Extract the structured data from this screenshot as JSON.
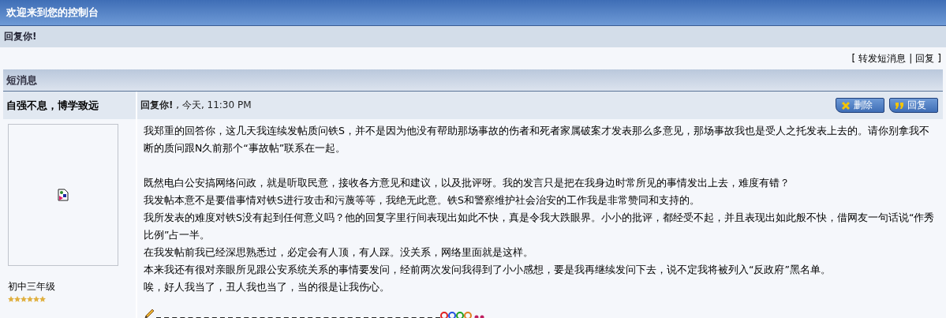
{
  "header": {
    "title": "欢迎来到您的控制台"
  },
  "subheader": {
    "title": "回复你!"
  },
  "links": {
    "open": "[",
    "items": [
      "转发短消息",
      "回复"
    ],
    "separator": "|",
    "close": "]"
  },
  "panel": {
    "title": "短消息",
    "author": {
      "name": "自强不息，博学致远",
      "rank": "初中三年级",
      "stars": 6
    },
    "message": {
      "title": "回复你!",
      "date": ", 今天, 11:30 PM",
      "buttons": [
        {
          "kind": "delete",
          "label": "删除"
        },
        {
          "kind": "reply",
          "label": "回复"
        }
      ],
      "paragraphs": [
        {
          "lines": [
            "我郑重的回答你，这几天我连续发帖质问铁S，并不是因为他没有帮助那场事故的伤者和死者家属破案才发表那么多意见，那场事故我也是受人之托发表上去的。请你别拿我不断的质问跟N久前那个“事故帖”联系在一起。"
          ]
        },
        {
          "lines": [
            "既然电白公安搞网络问政，就是听取民意，接收各方意见和建议，以及批评呀。我的发言只是把在我身边时常所见的事情发出上去，难度有错？",
            "我发帖本意不是要借事情对铁S进行攻击和污蔑等等，我绝无此意。铁S和警察维护社会治安的工作我是非常赞同和支持的。",
            "我所发表的难度对铁S没有起到任何意义吗？他的回复字里行间表现出如此不快，真是令我大跌眼界。小小的批评，都经受不起，并且表现出如此般不快，借网友一句话说“作秀比例”占一半。",
            "在我发帖前我已经深思熟悉过，必定会有人顶，有人踩。没关系，网络里面就是这样。",
            "本来我还有很对亲眼所见跟公安系统关系的事情要发问，经前两次发问我得到了小小感想，要是我再继续发问下去，说不定我将被列入“反政府”黑名单。",
            "唉，好人我当了，丑人我也当了，当的很是让我伤心。"
          ]
        }
      ]
    }
  }
}
